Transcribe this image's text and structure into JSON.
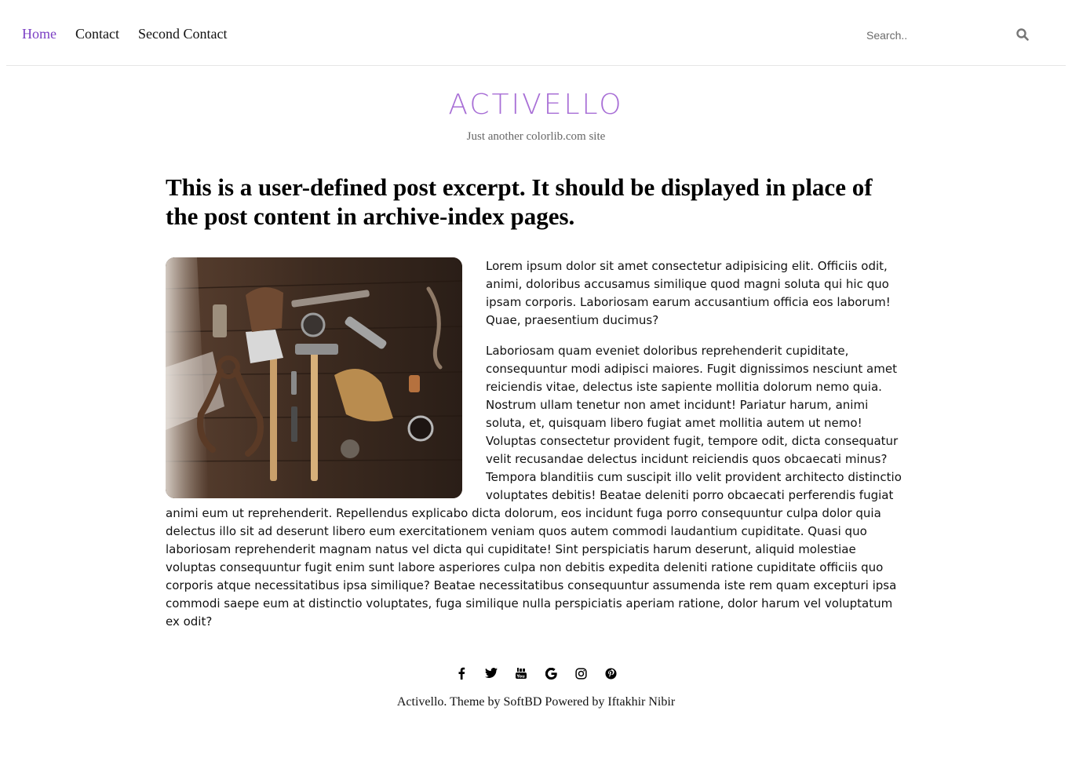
{
  "nav": {
    "items": [
      {
        "label": "Home",
        "active": true
      },
      {
        "label": "Contact",
        "active": false
      },
      {
        "label": "Second Contact",
        "active": false
      }
    ]
  },
  "search": {
    "placeholder": "Search..",
    "icon": "search-icon"
  },
  "site": {
    "title": "ACTIVELLO",
    "tagline": "Just another colorlib.com site"
  },
  "post": {
    "title": "This is a user-defined post excerpt. It should be displayed in place of the post content in archive-index pages.",
    "paragraphs": [
      "Lorem ipsum dolor sit amet consectetur adipisicing elit. Officiis odit, animi, doloribus accusamus similique quod magni soluta qui hic quo ipsam corporis. Laboriosam earum accusantium officia eos laborum! Quae, praesentium ducimus?",
      "Laboriosam quam eveniet doloribus reprehenderit cupiditate, consequuntur modi adipisci maiores. Fugit dignissimos nesciunt amet reiciendis vitae, delectus iste sapiente mollitia dolorum nemo quia. Nostrum ullam tenetur non amet incidunt! Pariatur harum, animi soluta, et, quisquam libero fugiat amet mollitia autem ut nemo! Voluptas consectetur provident fugit, tempore odit, dicta consequatur velit recusandae delectus incidunt reiciendis quos obcaecati minus? Tempora blanditiis cum suscipit illo velit provident architecto distinctio voluptates debitis! Beatae deleniti porro obcaecati perferendis fugiat animi eum ut reprehenderit. Repellendus explicabo dicta dolorum, eos incidunt fuga porro consequuntur culpa dolor quia delectus illo sit ad deserunt libero eum exercitationem veniam quos autem commodi laudantium cupiditate. Quasi quo laboriosam reprehenderit magnam natus vel dicta qui cupiditate! Sint perspiciatis harum deserunt, aliquid molestiae voluptas consequuntur fugit enim sunt labore asperiores culpa non debitis expedita deleniti ratione cupiditate officiis quo corporis atque necessitatibus ipsa similique? Beatae necessitatibus consequuntur assumenda iste rem quam excepturi ipsa commodi saepe eum at distinctio voluptates, fuga similique nulla perspiciatis aperiam ratione, dolor harum vel voluptatum ex odit?"
    ],
    "image": "tools-on-wooden-table-photo"
  },
  "social": [
    "facebook-icon",
    "twitter-icon",
    "youtube-icon",
    "google-icon",
    "instagram-icon",
    "pinterest-icon"
  ],
  "footer": {
    "credit": "Activello. Theme by SoftBD Powered by Iftakhir Nibir"
  },
  "colors": {
    "accent": "#7b3fc4",
    "logo": "#a86fd6"
  }
}
